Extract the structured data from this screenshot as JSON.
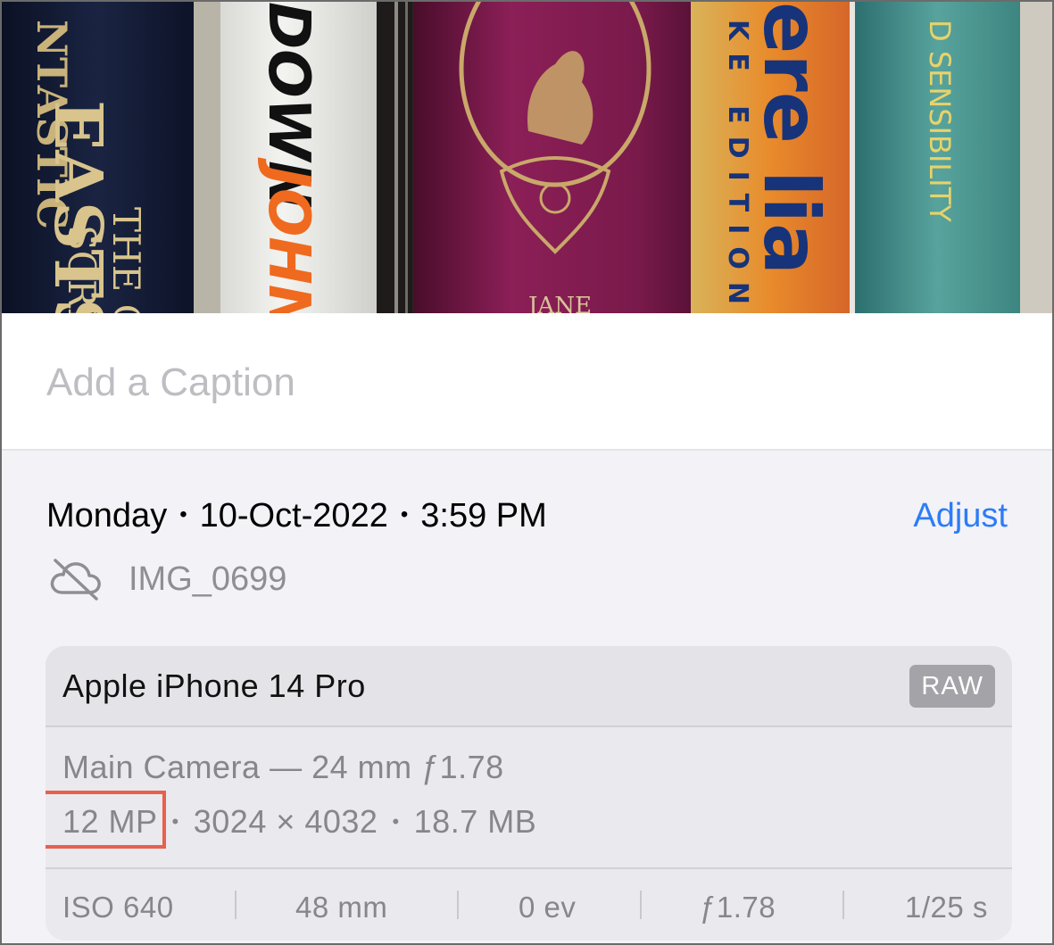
{
  "photo": {
    "spine_texts": [
      "NTASTIC",
      "EASTS",
      "THE OR",
      "SCREE",
      "DOWN",
      "JOHN",
      "JANE",
      "ere lia",
      "KE EDITION",
      "D SENSIBILITY"
    ]
  },
  "caption": {
    "placeholder": "Add a Caption"
  },
  "meta": {
    "day": "Monday",
    "date": "10-Oct-2022",
    "time": "3:59 PM",
    "separator": "•",
    "adjust_label": "Adjust",
    "icon": "cloud-slash-icon",
    "filename": "IMG_0699"
  },
  "camera": {
    "device": "Apple iPhone 14 Pro",
    "badge": "RAW",
    "lens": "Main Camera — 24 mm ƒ1.78",
    "megapixels": "12 MP",
    "resolution": "3024 × 4032",
    "size": "18.7 MB",
    "exif": {
      "iso": "ISO 640",
      "focal": "48 mm",
      "ev": "0 ev",
      "aperture": "ƒ1.78",
      "shutter": "1/25 s"
    }
  },
  "colors": {
    "accent": "#2d7cf6",
    "highlight": "#e8604e",
    "secondary_text": "#8e8e93"
  }
}
